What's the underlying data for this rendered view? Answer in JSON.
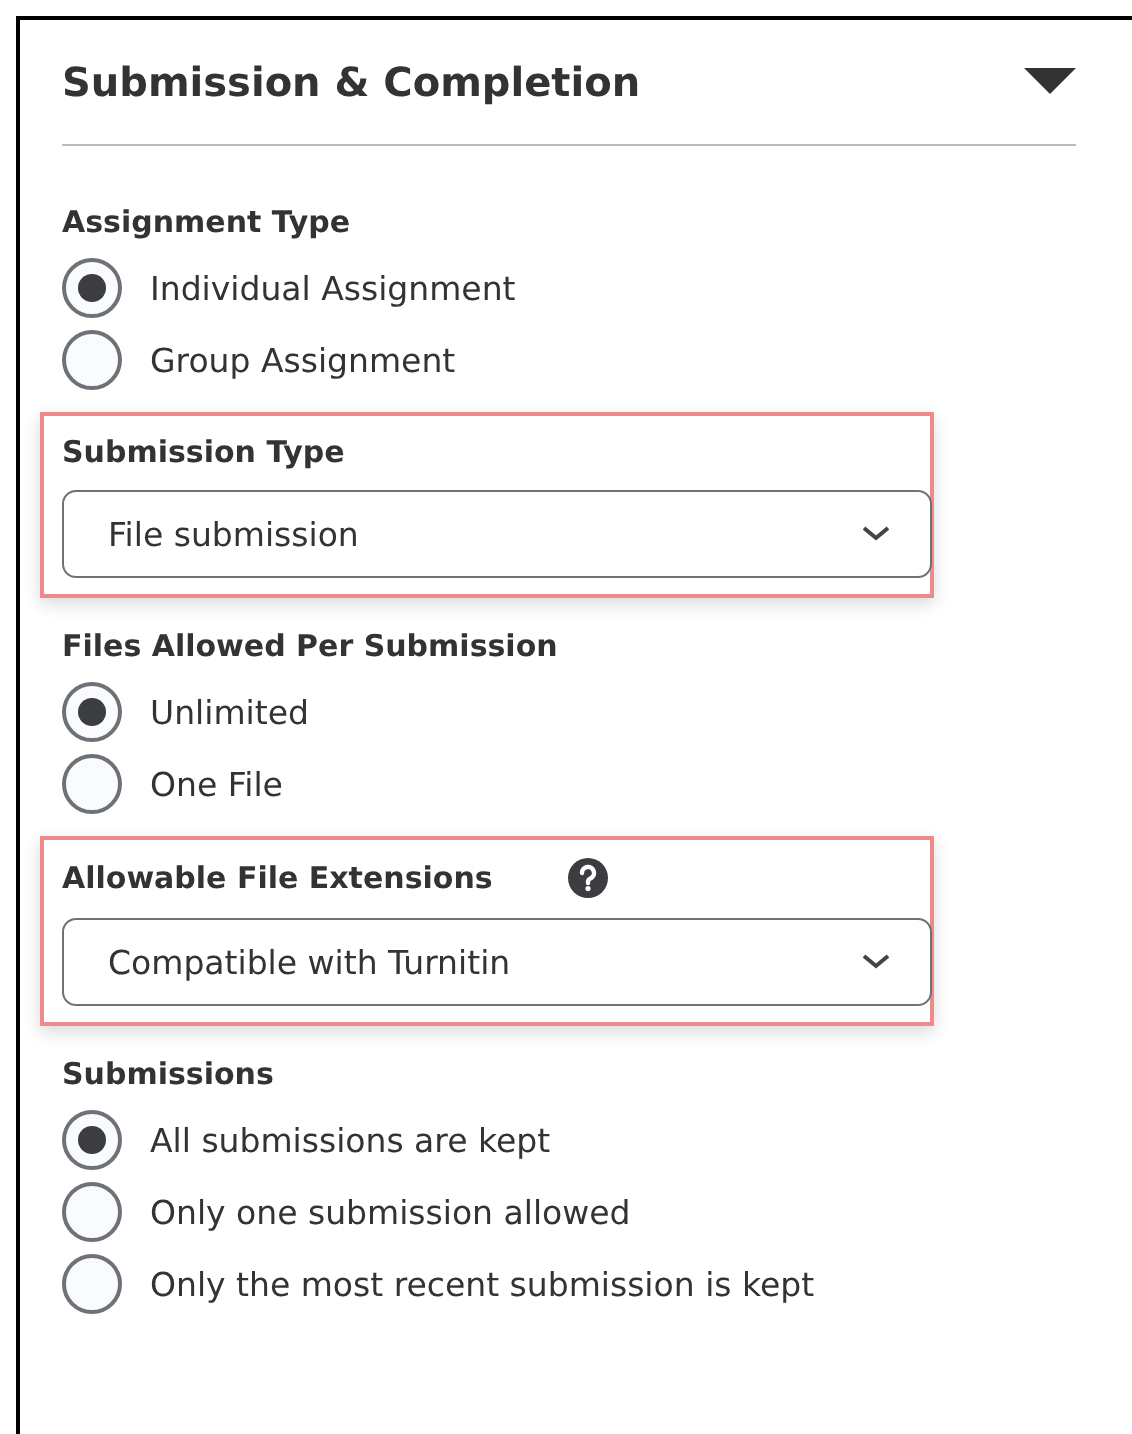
{
  "panel": {
    "title": "Submission & Completion",
    "expanded": true
  },
  "sections": [
    {
      "kind": "radio",
      "label": "Assignment Type",
      "highlighted": false,
      "options": [
        {
          "label": "Individual Assignment",
          "selected": true
        },
        {
          "label": "Group Assignment",
          "selected": false
        }
      ]
    },
    {
      "kind": "select",
      "label": "Submission Type",
      "highlighted": true,
      "value": "File submission"
    },
    {
      "kind": "radio",
      "label": "Files Allowed Per Submission",
      "highlighted": false,
      "options": [
        {
          "label": "Unlimited",
          "selected": true
        },
        {
          "label": "One File",
          "selected": false
        }
      ]
    },
    {
      "kind": "select",
      "label": "Allowable File Extensions",
      "highlighted": true,
      "help": true,
      "value": "Compatible with Turnitin"
    },
    {
      "kind": "radio",
      "label": "Submissions",
      "highlighted": false,
      "options": [
        {
          "label": "All submissions are kept",
          "selected": true
        },
        {
          "label": "Only one submission allowed",
          "selected": false
        },
        {
          "label": "Only the most recent submission is kept",
          "selected": false
        }
      ]
    }
  ]
}
